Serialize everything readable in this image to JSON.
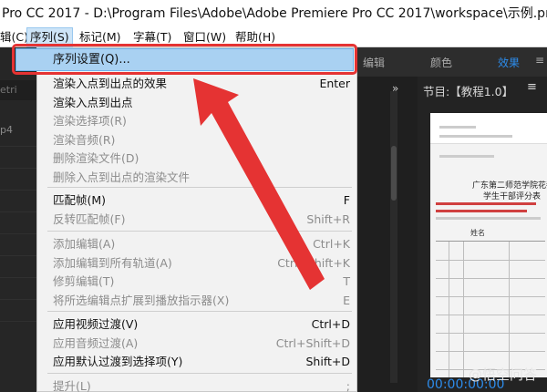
{
  "window": {
    "title": "Pro CC 2017 - D:\\Program Files\\Adobe\\Adobe Premiere Pro CC 2017\\workspace\\示例.prproj *"
  },
  "menubar": {
    "items": [
      {
        "label": "辑(C)"
      },
      {
        "label": "序列(S)"
      },
      {
        "label": "标记(M)"
      },
      {
        "label": "字幕(T)"
      },
      {
        "label": "窗口(W)"
      },
      {
        "label": "帮助(H)"
      }
    ]
  },
  "workspaces": {
    "items": [
      "编辑",
      "颜色",
      "效果"
    ],
    "more_icon": "≡"
  },
  "left_panel": {
    "header": "etri",
    "header_icon": "≫",
    "item_text": "p4"
  },
  "program_monitor": {
    "title": "节目:【教程1.0】",
    "menu_icon": "≡",
    "expand_icon": "»",
    "doc_title_line1": "广东第二师范学院花都校",
    "doc_title_line2": "学生干部评分表",
    "table_header": "姓名",
    "timecode": "00:00:00:00",
    "watermark": "@悟空问答"
  },
  "sequence_menu": {
    "highlighted": {
      "label": "序列设置(Q)..."
    },
    "groups": [
      [
        {
          "label": "渲染入点到出点的效果",
          "shortcut": "Enter",
          "enabled": true
        },
        {
          "label": "渲染入点到出点",
          "shortcut": "",
          "enabled": true
        },
        {
          "label": "渲染选择项(R)",
          "shortcut": "",
          "enabled": false
        },
        {
          "label": "渲染音频(R)",
          "shortcut": "",
          "enabled": false
        },
        {
          "label": "删除渲染文件(D)",
          "shortcut": "",
          "enabled": false
        },
        {
          "label": "删除入点到出点的渲染文件",
          "shortcut": "",
          "enabled": false
        }
      ],
      [
        {
          "label": "匹配帧(M)",
          "shortcut": "F",
          "enabled": true
        },
        {
          "label": "反转匹配帧(F)",
          "shortcut": "Shift+R",
          "enabled": false
        }
      ],
      [
        {
          "label": "添加编辑(A)",
          "shortcut": "Ctrl+K",
          "enabled": false
        },
        {
          "label": "添加编辑到所有轨道(A)",
          "shortcut": "Ctrl+Shift+K",
          "enabled": false
        },
        {
          "label": "修剪编辑(T)",
          "shortcut": "T",
          "enabled": false
        },
        {
          "label": "将所选编辑点扩展到播放指示器(X)",
          "shortcut": "E",
          "enabled": false
        }
      ],
      [
        {
          "label": "应用视频过渡(V)",
          "shortcut": "Ctrl+D",
          "enabled": true
        },
        {
          "label": "应用音频过渡(A)",
          "shortcut": "Ctrl+Shift+D",
          "enabled": false
        },
        {
          "label": "应用默认过渡到选择项(Y)",
          "shortcut": "Shift+D",
          "enabled": true
        }
      ],
      [
        {
          "label": "提升(L)",
          "shortcut": ";",
          "enabled": false
        }
      ]
    ]
  },
  "colors": {
    "highlight": "#a9d1f2",
    "annotation_red": "#e53333",
    "workspace_active": "#2d8ceb",
    "menu_bg": "#f2f2f2",
    "disabled_text": "#8c8c8c"
  }
}
